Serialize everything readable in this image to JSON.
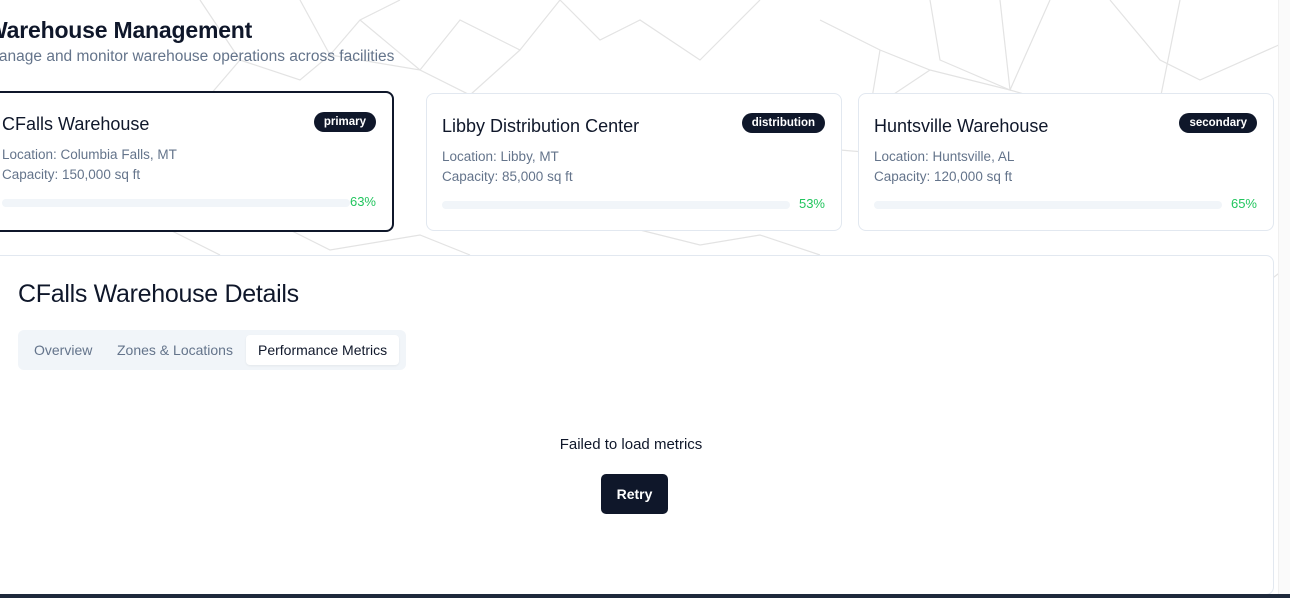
{
  "header": {
    "title": "Warehouse Management",
    "subtitle": "Manage and monitor warehouse operations across facilities"
  },
  "warehouses": [
    {
      "name": "CFalls Warehouse",
      "badge": "primary",
      "location": "Location: Columbia Falls, MT",
      "capacity": "Capacity: 150,000 sq ft",
      "utilization_pct": "63%",
      "utilization": 0.63,
      "selected": true
    },
    {
      "name": "Libby Distribution Center",
      "badge": "distribution",
      "location": "Location: Libby, MT",
      "capacity": "Capacity: 85,000 sq ft",
      "utilization_pct": "53%",
      "utilization": 0.53,
      "selected": false
    },
    {
      "name": "Huntsville Warehouse",
      "badge": "secondary",
      "location": "Location: Huntsville, AL",
      "capacity": "Capacity: 120,000 sq ft",
      "utilization_pct": "65%",
      "utilization": 0.65,
      "selected": false
    }
  ],
  "details": {
    "title": "CFalls Warehouse Details",
    "tabs": [
      {
        "label": "Overview",
        "active": false
      },
      {
        "label": "Zones & Locations",
        "active": false
      },
      {
        "label": "Performance Metrics",
        "active": true
      }
    ],
    "error_message": "Failed to load metrics",
    "retry_label": "Retry"
  },
  "colors": {
    "primary": "#0f172a",
    "muted_text": "#64748b",
    "success": "#22c55e",
    "border": "#e2e8f0",
    "tab_bg": "#f1f5f9"
  }
}
